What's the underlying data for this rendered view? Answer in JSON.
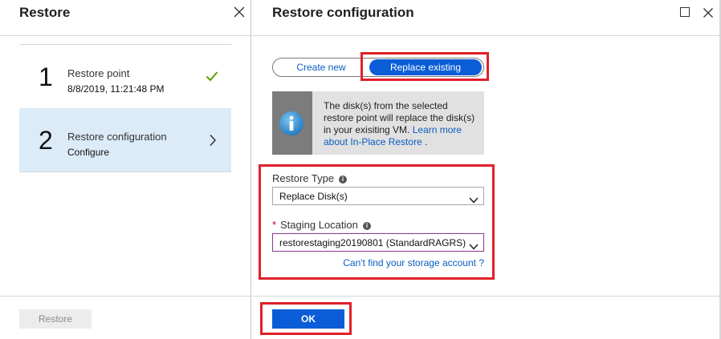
{
  "left_panel": {
    "title": "Restore",
    "close_icon": "close-icon",
    "steps": [
      {
        "number": "1",
        "title": "Restore point",
        "subtitle": "8/8/2019, 11:21:48 PM",
        "status_icon": "checkmark-icon",
        "selected": false
      },
      {
        "number": "2",
        "title": "Restore configuration",
        "subtitle": "Configure",
        "status_icon": "chevron-right-icon",
        "selected": true
      }
    ],
    "restore_button": "Restore"
  },
  "right_panel": {
    "title": "Restore configuration",
    "maximize_icon": "maximize-icon",
    "close_icon": "close-icon",
    "toggle": {
      "options": [
        "Create new",
        "Replace existing"
      ],
      "selected": "Replace existing"
    },
    "info_box": {
      "icon": "info-icon",
      "text": "The disk(s) from the selected restore point will replace the disk(s) in your exisiting VM.",
      "link_text": "Learn more about In-Place Restore",
      "trailing": "."
    },
    "restore_type": {
      "label": "Restore Type",
      "info_icon": "info-icon",
      "value": "Replace Disk(s)"
    },
    "staging_location": {
      "required_marker": "*",
      "label": "Staging Location",
      "info_icon": "info-icon",
      "value": "restorestaging20190801 (StandardRAGRS)"
    },
    "storage_link": "Can't find your storage account ?",
    "ok_button": "OK"
  },
  "colors": {
    "accent_blue": "#0a5dd6",
    "link_blue": "#0a5dbf",
    "highlight_red": "#e0202a",
    "selected_step_bg": "#dcebf8",
    "success_green": "#57a300"
  }
}
